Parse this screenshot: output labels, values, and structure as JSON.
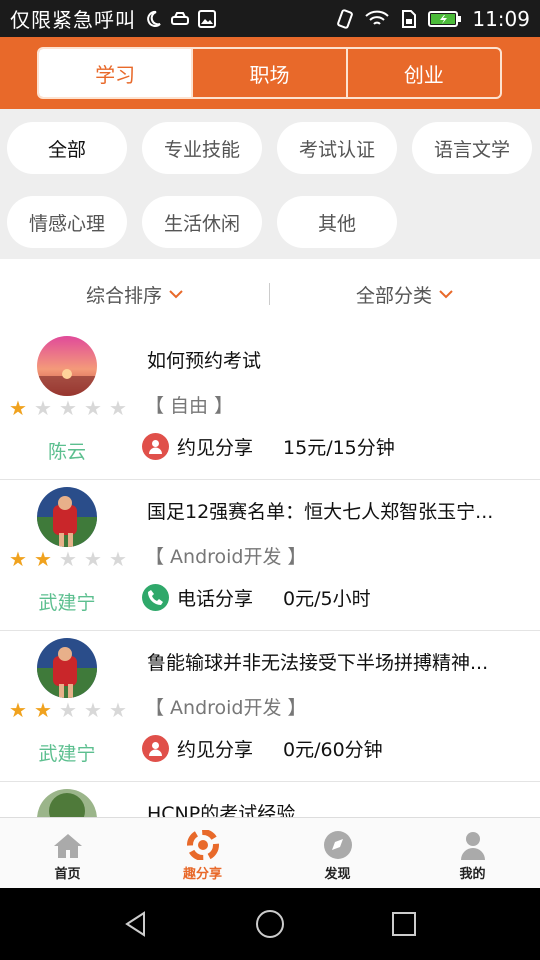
{
  "status_bar": {
    "carrier": "仅限紧急呼叫",
    "time": "11:09",
    "icons": [
      "moon-icon",
      "car-icon",
      "image-icon",
      "vibrate-icon",
      "wifi-icon",
      "sim-icon",
      "battery-icon"
    ]
  },
  "top_tabs": [
    {
      "label": "学习",
      "active": true
    },
    {
      "label": "职场",
      "active": false
    },
    {
      "label": "创业",
      "active": false
    }
  ],
  "categories": [
    {
      "label": "全部",
      "active": true
    },
    {
      "label": "专业技能",
      "active": false
    },
    {
      "label": "考试认证",
      "active": false
    },
    {
      "label": "语言文学",
      "active": false
    },
    {
      "label": "情感心理",
      "active": false
    },
    {
      "label": "生活休闲",
      "active": false
    },
    {
      "label": "其他",
      "active": false
    }
  ],
  "sort": {
    "left_label": "综合排序",
    "right_label": "全部分类"
  },
  "items": [
    {
      "title": "如何预约考试",
      "tag": "【 自由 】",
      "user": "陈云",
      "rating": 1,
      "share_type": "约见分享",
      "share_icon": "person-icon",
      "price": "15元/15分钟",
      "avatar": "sunset"
    },
    {
      "title": "国足12强赛名单：恒大七人郑智张玉宁...",
      "tag": "【 Android开发 】",
      "user": "武建宁",
      "rating": 2,
      "share_type": "电话分享",
      "share_icon": "phone-icon",
      "price": "0元/5小时",
      "avatar": "soccer"
    },
    {
      "title": "鲁能输球并非无法接受下半场拼搏精神...",
      "tag": "【 Android开发 】",
      "user": "武建宁",
      "rating": 2,
      "share_type": "约见分享",
      "share_icon": "person-icon",
      "price": "0元/60分钟",
      "avatar": "soccer"
    },
    {
      "title": "HCNP的考试经验",
      "tag": "",
      "user": "",
      "rating": 0,
      "share_type": "",
      "share_icon": "",
      "price": "",
      "avatar": "tree"
    }
  ],
  "bottom_nav": [
    {
      "label": "首页",
      "icon": "home-icon",
      "active": false
    },
    {
      "label": "趣分享",
      "icon": "share-circle-icon",
      "active": true
    },
    {
      "label": "发现",
      "icon": "compass-icon",
      "active": false
    },
    {
      "label": "我的",
      "icon": "user-icon",
      "active": false
    }
  ],
  "colors": {
    "accent": "#e8692a",
    "username": "#5cbf8f",
    "star_on": "#f0a21e"
  }
}
